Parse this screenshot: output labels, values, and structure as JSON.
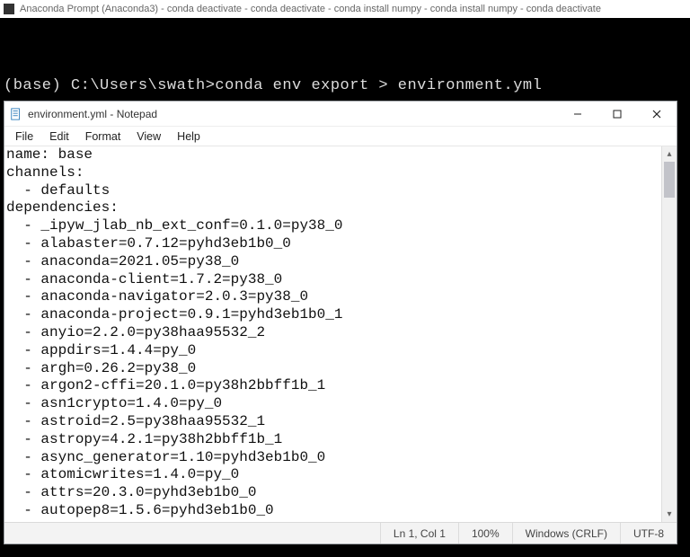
{
  "console": {
    "title": "Anaconda Prompt (Anaconda3) - conda  deactivate - conda  deactivate - conda  install numpy - conda  install numpy - conda  deactivate",
    "prompt_line": "(base) C:\\Users\\swath>conda env export > environment.yml"
  },
  "notepad": {
    "title": "environment.yml - Notepad",
    "menu": {
      "file": "File",
      "edit": "Edit",
      "format": "Format",
      "view": "View",
      "help": "Help"
    },
    "file_text": "name: base\nchannels:\n  - defaults\ndependencies:\n  - _ipyw_jlab_nb_ext_conf=0.1.0=py38_0\n  - alabaster=0.7.12=pyhd3eb1b0_0\n  - anaconda=2021.05=py38_0\n  - anaconda-client=1.7.2=py38_0\n  - anaconda-navigator=2.0.3=py38_0\n  - anaconda-project=0.9.1=pyhd3eb1b0_1\n  - anyio=2.2.0=py38haa95532_2\n  - appdirs=1.4.4=py_0\n  - argh=0.26.2=py38_0\n  - argon2-cffi=20.1.0=py38h2bbff1b_1\n  - asn1crypto=1.4.0=py_0\n  - astroid=2.5=py38haa95532_1\n  - astropy=4.2.1=py38h2bbff1b_1\n  - async_generator=1.10=pyhd3eb1b0_0\n  - atomicwrites=1.4.0=py_0\n  - attrs=20.3.0=pyhd3eb1b0_0\n  - autopep8=1.5.6=pyhd3eb1b0_0",
    "status": {
      "position": "Ln 1, Col 1",
      "zoom": "100%",
      "line_ending": "Windows (CRLF)",
      "encoding": "UTF-8"
    }
  }
}
